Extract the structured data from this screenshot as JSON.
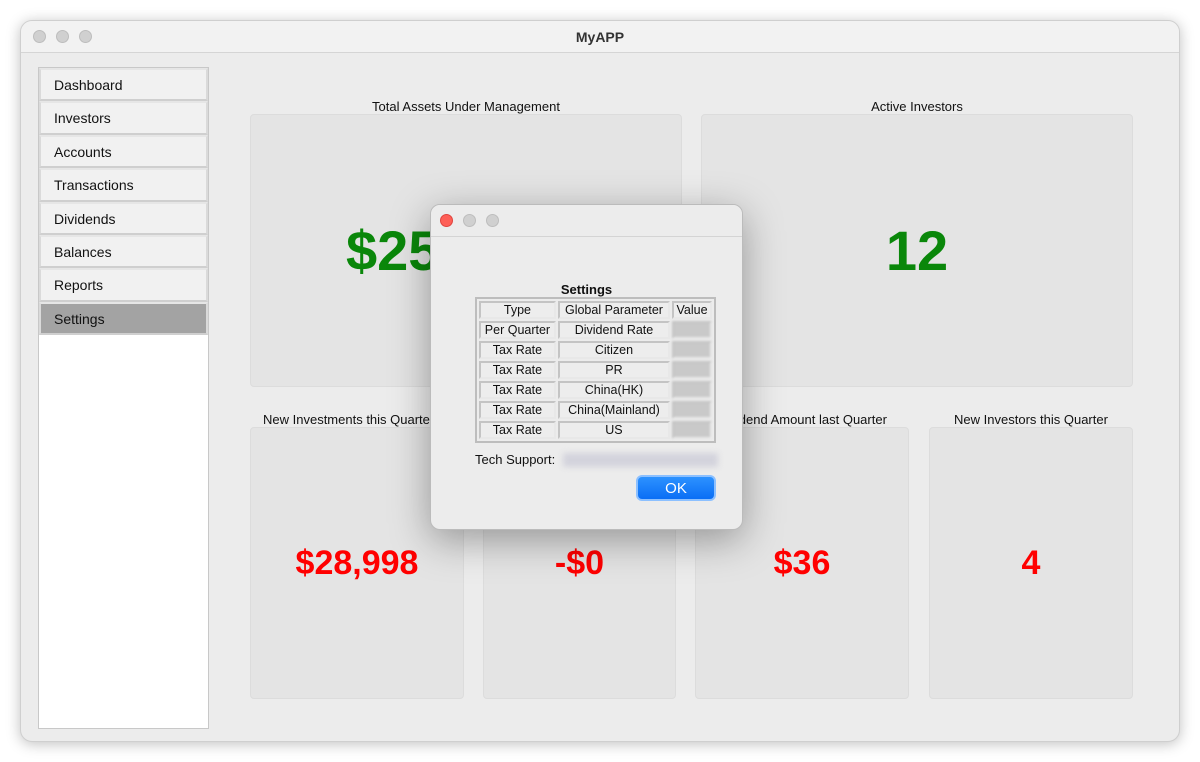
{
  "window": {
    "title": "MyAPP"
  },
  "sidebar": {
    "items": [
      {
        "label": "Dashboard"
      },
      {
        "label": "Investors"
      },
      {
        "label": "Accounts"
      },
      {
        "label": "Transactions"
      },
      {
        "label": "Dividends"
      },
      {
        "label": "Balances"
      },
      {
        "label": "Reports"
      },
      {
        "label": "Settings",
        "selected": true
      }
    ]
  },
  "dashboard": {
    "total_assets": {
      "label": "Total Assets Under Management",
      "value": "$25"
    },
    "active_investors": {
      "label": "Active Investors",
      "value": "12"
    },
    "new_investments": {
      "label": "New Investments this Quarter",
      "value": "$28,998"
    },
    "third": {
      "label": "",
      "value": "-$0"
    },
    "dividend_amount": {
      "label": "Dividend Amount last Quarter",
      "value": "$36"
    },
    "new_investors": {
      "label": "New Investors this Quarter",
      "value": "4"
    },
    "colors": {
      "positive": "#0a870a",
      "negative": "#ff0000"
    }
  },
  "dialog": {
    "title": "Settings",
    "headers": [
      "Type",
      "Global Parameter",
      "Value"
    ],
    "rows": [
      [
        "Per Quarter",
        "Dividend Rate"
      ],
      [
        "Tax Rate",
        "Citizen"
      ],
      [
        "Tax Rate",
        "PR"
      ],
      [
        "Tax Rate",
        "China(HK)"
      ],
      [
        "Tax Rate",
        "China(Mainland)"
      ],
      [
        "Tax Rate",
        "US"
      ]
    ],
    "tech_support_label": "Tech Support:",
    "ok_label": "OK"
  }
}
